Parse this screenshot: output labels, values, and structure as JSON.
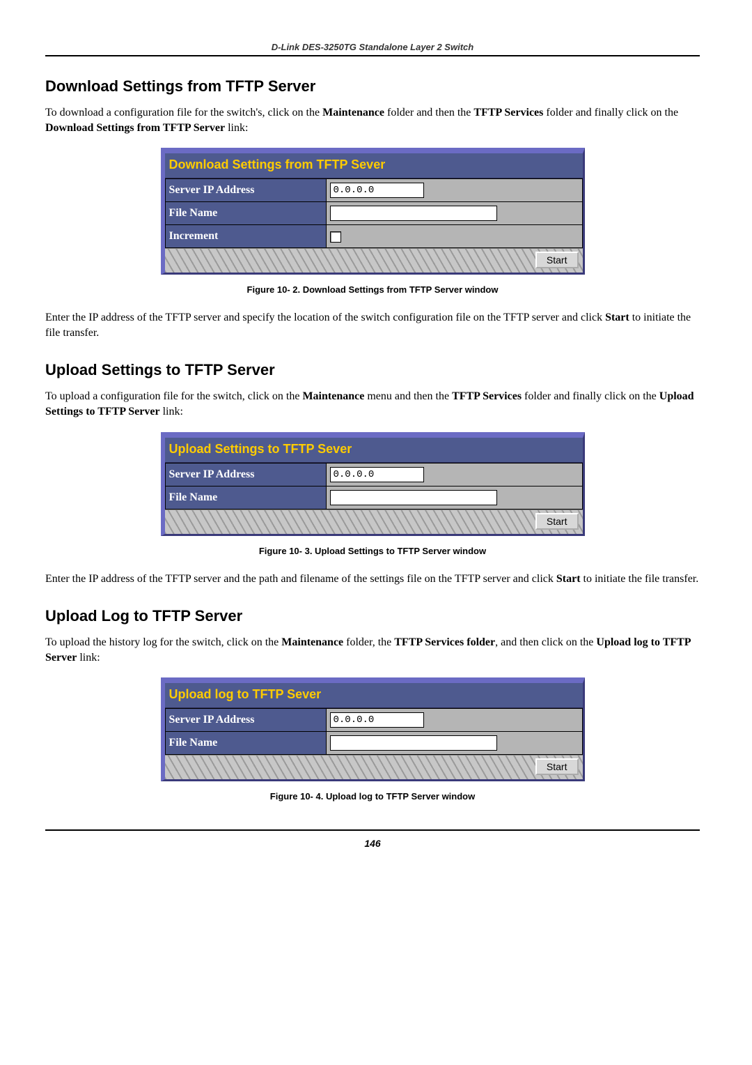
{
  "header": {
    "running_title": "D-Link DES-3250TG Standalone Layer 2 Switch"
  },
  "sections": {
    "download": {
      "heading": "Download Settings from TFTP Server",
      "para_pre": "To download a configuration file for the switch's, click on the ",
      "para_b1": "Maintenance",
      "para_mid1": " folder and then the ",
      "para_b2": "TFTP Services",
      "para_mid2": " folder and finally click on the ",
      "para_b3": "Download Settings from TFTP Server",
      "para_post": " link:",
      "panel_title": "Download Settings from TFTP Sever",
      "row_ip_label": "Server IP Address",
      "row_ip_value": "0.0.0.0",
      "row_file_label": "File Name",
      "row_file_value": "",
      "row_inc_label": "Increment",
      "start_label": "Start",
      "caption": "Figure 10- 2.  Download Settings from TFTP Server window",
      "after_pre": "Enter the IP address of the TFTP server and specify the location of the switch configuration file on the TFTP server and click ",
      "after_b": "Start",
      "after_post": " to initiate the file transfer."
    },
    "upload_settings": {
      "heading": "Upload Settings to TFTP Server",
      "para_pre": "To upload a configuration file for the switch, click on the ",
      "para_b1": "Maintenance",
      "para_mid1": " menu and then the ",
      "para_b2": "TFTP Services",
      "para_mid2": " folder and finally click on the ",
      "para_b3": "Upload Settings to TFTP Server",
      "para_post": " link:",
      "panel_title": "Upload Settings to TFTP Sever",
      "row_ip_label": "Server IP Address",
      "row_ip_value": "0.0.0.0",
      "row_file_label": "File Name",
      "row_file_value": "",
      "start_label": "Start",
      "caption": "Figure 10- 3.  Upload Settings to TFTP Server window",
      "after_pre": "Enter the IP address of the TFTP server and the path and filename of the settings file on the TFTP server and click ",
      "after_b": "Start",
      "after_post": " to initiate the file transfer."
    },
    "upload_log": {
      "heading": "Upload Log to TFTP Server",
      "para_pre": "To upload the history log for the switch, click on the ",
      "para_b1": "Maintenance",
      "para_mid1": " folder, the ",
      "para_b2": "TFTP Services folder",
      "para_mid2": ", and then click on the ",
      "para_b3": "Upload log to TFTP Server",
      "para_post": " link:",
      "panel_title": "Upload log to TFTP Sever",
      "row_ip_label": "Server IP Address",
      "row_ip_value": "0.0.0.0",
      "row_file_label": "File Name",
      "row_file_value": "",
      "start_label": "Start",
      "caption": "Figure 10- 4.  Upload log to TFTP Server window"
    }
  },
  "page_number": "146"
}
